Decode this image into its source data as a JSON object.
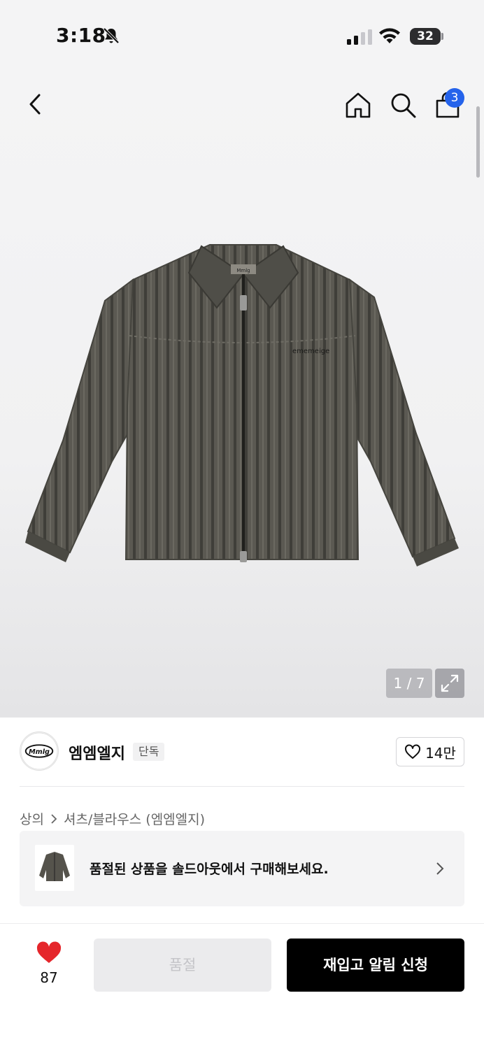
{
  "status_bar": {
    "time": "3:18",
    "battery": "32",
    "icons": [
      "bell-slash-icon",
      "signal-icon",
      "wifi-icon",
      "battery-icon"
    ]
  },
  "header": {
    "icons": [
      "back-icon",
      "home-icon",
      "search-icon",
      "cart-icon"
    ],
    "cart_count": "3"
  },
  "gallery": {
    "counter": "1 / 7",
    "expand_icon": "expand-icon",
    "brand_print": "ememeige",
    "tag_print": "Mmlg"
  },
  "brand": {
    "logo_text": "Mmlg",
    "name": "엠엠엘지",
    "badge": "단독",
    "likes": "14만"
  },
  "breadcrumb": {
    "category": "상의",
    "subcategory": "셔츠/블라우스 (엠엠엘지)"
  },
  "banner": {
    "text": "품절된 상품을 솔드아웃에서 구매해보세요."
  },
  "bottom_bar": {
    "wish_count": "87",
    "soldout_label": "품절",
    "restock_label": "재입고 알림 신청"
  },
  "colors": {
    "accent": "#2563eb",
    "heart": "#e5262b",
    "jacket": "#55534c"
  }
}
